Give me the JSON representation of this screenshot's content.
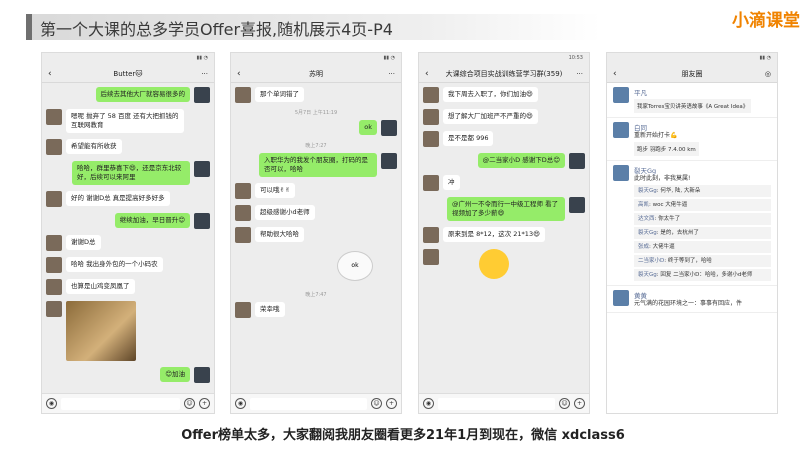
{
  "slide": {
    "title": "第一个大课的总多学员Offer喜报,随机展示4页-P4",
    "brand": "小滴课堂",
    "caption": "Offer榜单太多，大家翻阅我朋友圈看更多21年1月到现在，微信 xdclass6",
    "colors": {
      "brand": "#f08300",
      "bubble_self": "#95ec69",
      "chat_bg": "#ededed"
    }
  },
  "phones": [
    {
      "title": "Butter🐱",
      "messages": [
        {
          "side": "r",
          "text": "后续去其他大厂就容易很多的"
        },
        {
          "side": "l",
          "text": "嗯呢 抛弃了 58 百度 还有大把抓钱的互联网教育"
        },
        {
          "side": "l",
          "text": "希望能有所收获"
        },
        {
          "side": "r",
          "text": "哈哈，群里恭喜下😄，还是京东北较好，后续可以来阿里"
        },
        {
          "side": "l",
          "text": "好的 谢谢D总 真是提高好多好多"
        },
        {
          "side": "r",
          "text": "继续加油，早日晋升😊"
        },
        {
          "side": "l",
          "text": "谢谢D总"
        },
        {
          "side": "l",
          "text": "哈哈 我出身外包的一个小码农"
        },
        {
          "side": "l",
          "text": "也算是山鸡变凤凰了"
        },
        {
          "side": "r",
          "text": "😊加油"
        }
      ]
    },
    {
      "title": "苏明",
      "messages": [
        {
          "side": "l",
          "text": "那个单词错了"
        },
        {
          "side": "time",
          "text": "5月7日 上午11:19"
        },
        {
          "side": "r",
          "text": "ok"
        },
        {
          "side": "time",
          "text": "晚上7:27"
        },
        {
          "side": "r",
          "text": "入职华为的我发个朋友圈，打码的是否可以，哈哈"
        },
        {
          "side": "l",
          "text": "可以哦✌✌"
        },
        {
          "side": "l",
          "text": "超级感谢小d老师"
        },
        {
          "side": "l",
          "text": "帮助很大哈哈"
        },
        {
          "side": "time",
          "text": "晚上7:47"
        },
        {
          "side": "l",
          "text": "荣幸哦"
        }
      ],
      "sticker": "ok"
    },
    {
      "title": "大课综合项目实战训练营学习群(359)",
      "status_time": "10:53",
      "messages": [
        {
          "side": "l",
          "text": "我下周去入职了，你们加油😄"
        },
        {
          "side": "l",
          "text": "想了解大厂加班严不严重的😄"
        },
        {
          "side": "l",
          "text": "是不是都 996"
        },
        {
          "side": "r",
          "text": "@二当家小D 感谢下D总😊"
        },
        {
          "side": "l",
          "text": "冲"
        },
        {
          "side": "r",
          "text": "@广州一不令而行一中级工程师 看了视频加了多少薪😄"
        },
        {
          "side": "l",
          "text": "原来到是 8*12，这次 21*13😄"
        }
      ]
    },
    {
      "title": "朋友圈",
      "moments": [
        {
          "name": "平凡",
          "text": "我家Torres宝贝讲英语故事《A Great Idea》"
        },
        {
          "name": "白同",
          "text": "重新开始打卡💪",
          "card": "跑步 羽跑步 7.4.00 km"
        },
        {
          "name": "裂天Gg",
          "text": "此时此刻，非我莫属!"
        },
        {
          "name": "",
          "text": "",
          "comments": [
            {
              "who": "裂天Gg",
              "text": "何华, 陆, 大新朵"
            },
            {
              "who": "高凯",
              "text": "woc 大佬牛逼"
            },
            {
              "who": "达文西",
              "text": "你太牛了"
            },
            {
              "who": "裂天Gg",
              "text": "是的，去杭州了"
            },
            {
              "who": "张成",
              "text": "大佬牛逼"
            },
            {
              "who": "二当家小D",
              "text": "终于等到了，哈哈"
            },
            {
              "who": "裂天Gg",
              "text": "回复 二当家小D：哈哈，多谢小d老师"
            }
          ]
        },
        {
          "name": "黄黄",
          "text": "元气满的花园环境之一：事事有回应，件"
        }
      ]
    }
  ]
}
